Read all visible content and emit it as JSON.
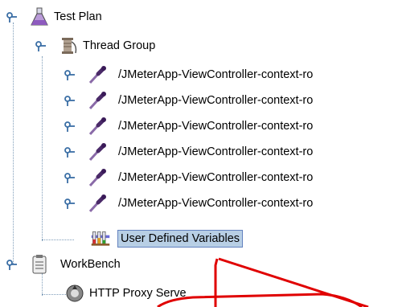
{
  "tree": {
    "root": {
      "label": "Test Plan",
      "icon": "flask-icon"
    },
    "thread_group": {
      "label": "Thread Group",
      "icon": "spool-icon"
    },
    "samplers": [
      {
        "label": "/JMeterApp-ViewController-context-ro",
        "icon": "pipette-icon"
      },
      {
        "label": "/JMeterApp-ViewController-context-ro",
        "icon": "pipette-icon"
      },
      {
        "label": "/JMeterApp-ViewController-context-ro",
        "icon": "pipette-icon"
      },
      {
        "label": "/JMeterApp-ViewController-context-ro",
        "icon": "pipette-icon"
      },
      {
        "label": "/JMeterApp-ViewController-context-ro",
        "icon": "pipette-icon"
      },
      {
        "label": "/JMeterApp-ViewController-context-ro",
        "icon": "pipette-icon"
      }
    ],
    "user_defined_variables": {
      "label": "User Defined Variables",
      "icon": "test-tubes-icon"
    },
    "workbench": {
      "label": "WorkBench",
      "icon": "clipboard-icon"
    },
    "proxy": {
      "label": "HTTP Proxy Serve",
      "icon": "proxy-icon"
    }
  },
  "colors": {
    "selection": "#b8cfe5",
    "annotation": "#e00000",
    "guide": "#7f9db9",
    "handle": "#3a6ea5"
  }
}
